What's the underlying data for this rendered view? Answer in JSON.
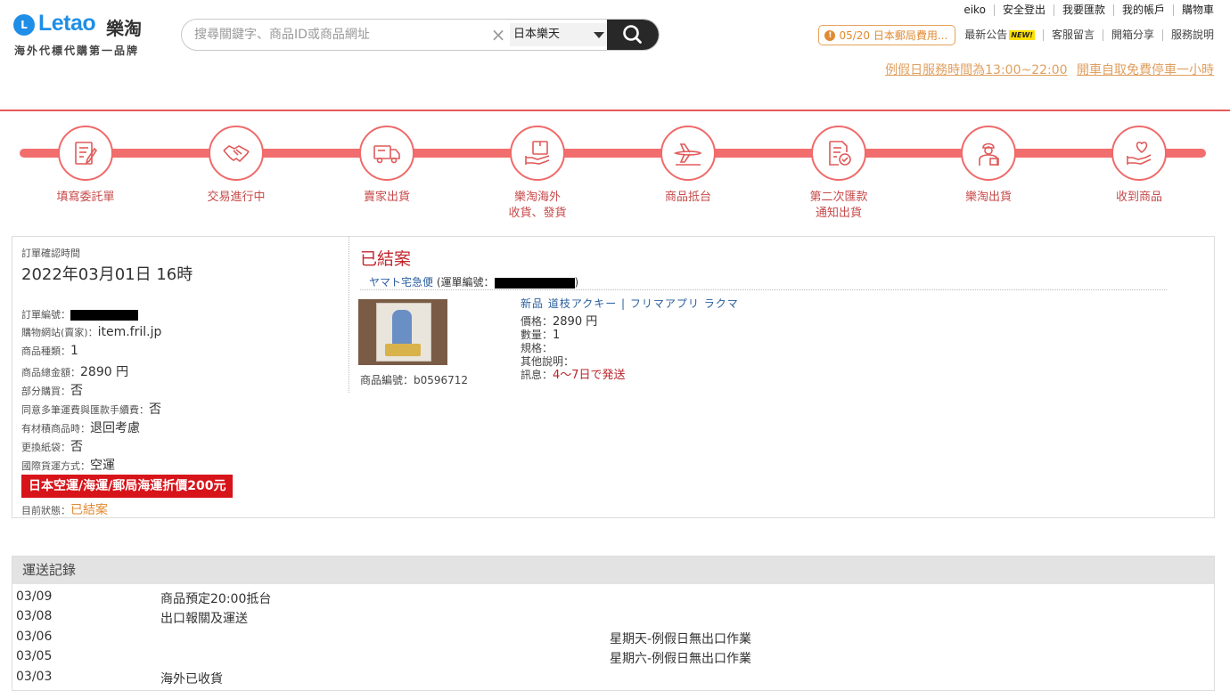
{
  "header": {
    "logo": {
      "mark": "L",
      "word": "Letao",
      "cn": "樂淘",
      "slogan": "海外代標代購第一品牌"
    },
    "search": {
      "placeholder": "搜尋關鍵字、商品ID或商品網址",
      "site": "日本樂天"
    },
    "top_links": [
      "eiko",
      "安全登出",
      "我要匯款",
      "我的帳戶",
      "購物車"
    ],
    "notice": "05/20 日本郵局費用...",
    "latest_news": "最新公告",
    "new_badge": "NEW!",
    "nav_links": [
      "客服留言",
      "開箱分享",
      "服務說明"
    ],
    "service_hours": "例假日服務時間為13:00~22:00",
    "parking": "開車自取免費停車一小時"
  },
  "steps": [
    {
      "label": "填寫委託單",
      "icon": "form-icon"
    },
    {
      "label": "交易進行中",
      "icon": "handshake-icon"
    },
    {
      "label": "賣家出貨",
      "icon": "truck-icon"
    },
    {
      "label": "樂淘海外\n收貨、發貨",
      "icon": "package-hand-icon"
    },
    {
      "label": "商品抵台",
      "icon": "airplane-icon"
    },
    {
      "label": "第二次匯款\n通知出貨",
      "icon": "invoice-check-icon"
    },
    {
      "label": "樂淘出貨",
      "icon": "courier-icon"
    },
    {
      "label": "收到商品",
      "icon": "heart-hand-icon"
    }
  ],
  "order": {
    "confirm_label": "訂單確認時間",
    "confirm_time": "2022年03月01日 16時",
    "order_no_label": "訂單編號：",
    "site_label": "購物網站(賣家)：",
    "site_value": "item.fril.jp",
    "item_count_label": "商品種類：",
    "item_count": "1",
    "total_label": "商品總金額：",
    "total": "2890 円",
    "partial_label": "部分購買：",
    "partial": "否",
    "multi_fee_label": "同意多筆運費與匯款手續費：",
    "multi_fee": "否",
    "oos_label": "有材積商品時：",
    "oos": "退回考慮",
    "bag_label": "更換紙袋：",
    "bag": "否",
    "shipping_method_label": "國際貨運方式：",
    "shipping_method": "空運",
    "promo": "日本空運/海運/郵局海運折價200元",
    "status_label": "目前狀態：",
    "status": "已結案"
  },
  "detail": {
    "status_title": "已結案",
    "carrier": "ヤマト宅急便",
    "tracking_label": "(運單編號：",
    "tracking_close": ")",
    "product_id": "商品編號：b0596712",
    "product_name": "新品 道枝アクキー | フリマアプリ ラクマ",
    "price_label": "價格：",
    "price": "2890 円",
    "qty_label": "數量：",
    "qty": "1",
    "spec_label": "規格：",
    "other_label": "其他說明：",
    "msg_label": "訊息：",
    "msg": "4～7日で発送"
  },
  "shipping_log": {
    "title": "運送記錄",
    "rows": [
      {
        "date": "03/09",
        "event": "商品預定20:00抵台",
        "note": ""
      },
      {
        "date": "03/08",
        "event": "出口報關及運送",
        "note": ""
      },
      {
        "date": "03/06",
        "event": "",
        "note": "星期天-例假日無出口作業"
      },
      {
        "date": "03/05",
        "event": "",
        "note": "星期六-例假日無出口作業"
      },
      {
        "date": "03/03",
        "event": "海外已收貨",
        "note": ""
      }
    ]
  }
}
